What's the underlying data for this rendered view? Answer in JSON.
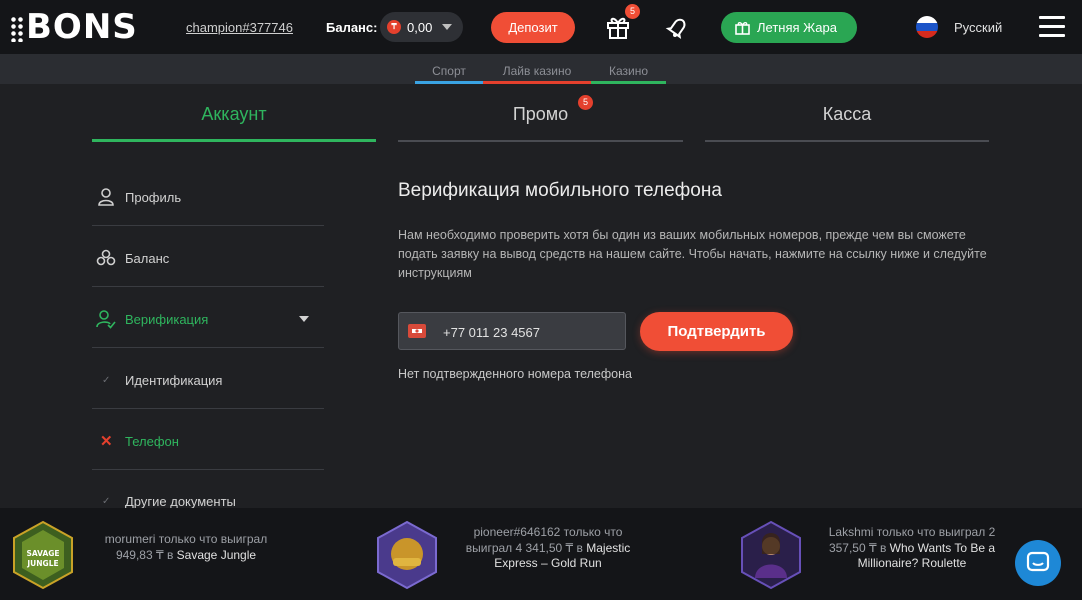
{
  "header": {
    "logo_text": "BONS",
    "username": "champion#377746",
    "balance_label": "Баланс:",
    "currency_symbol": "₸",
    "balance_amount": "0,00",
    "deposit_label": "Депозит",
    "gift_badge": "5",
    "promo_label": "Летняя Жара",
    "language": "Русский"
  },
  "subnav": {
    "items": [
      {
        "label": "Спорт",
        "color": "#3aa3e3"
      },
      {
        "label": "Лайв казино",
        "color": "#e4402d"
      },
      {
        "label": "Казино",
        "color": "#2fb55e"
      }
    ]
  },
  "tabs": [
    {
      "label": "Аккаунт",
      "active": true
    },
    {
      "label": "Промо",
      "badge": "5"
    },
    {
      "label": "Касса"
    }
  ],
  "sidebar": {
    "items": [
      {
        "label": "Профиль",
        "icon": "user-icon"
      },
      {
        "label": "Баланс",
        "icon": "coins-icon"
      },
      {
        "label": "Верификация",
        "icon": "user-check-icon"
      },
      {
        "label": "Идентификация",
        "icon": "check-icon"
      },
      {
        "label": "Телефон",
        "icon": "cross-icon"
      },
      {
        "label": "Другие документы",
        "icon": "check-icon"
      }
    ]
  },
  "main": {
    "title": "Верификация мобильного телефона",
    "description": "Нам необходимо проверить хотя бы один из ваших мобильных номеров, прежде чем вы сможете подать заявку на вывод средств на нашем сайте. Чтобы начать, нажмите на ссылку ниже и следуйте инструкциям",
    "phone_value": "+77 011 23 4567",
    "confirm_label": "Подтвердить",
    "no_phone_text": "Нет подтвержденного номера телефона"
  },
  "winners": [
    {
      "prefix": "morumeri только что выиграл 949,83 ₸ в ",
      "game": "Savage Jungle",
      "img_label": "SAVAGE JUNGLE"
    },
    {
      "prefix": "pioneer#646162 только что выиграл 4 341,50 ₸ в ",
      "game": "Majestic Express – Gold Run",
      "img_label": "MAJESTIC EXPRESS"
    },
    {
      "prefix": "Lakshmi только что выиграл 2 357,50 ₸ в ",
      "game": "Who Wants To Be a Millionaire? Roulette",
      "img_label": "WHO WANTS TO BE A MILLIONAIRE"
    }
  ],
  "colors": {
    "accent_green": "#2fb55e",
    "accent_red": "#f04e36",
    "chat_blue": "#1e88d6"
  }
}
